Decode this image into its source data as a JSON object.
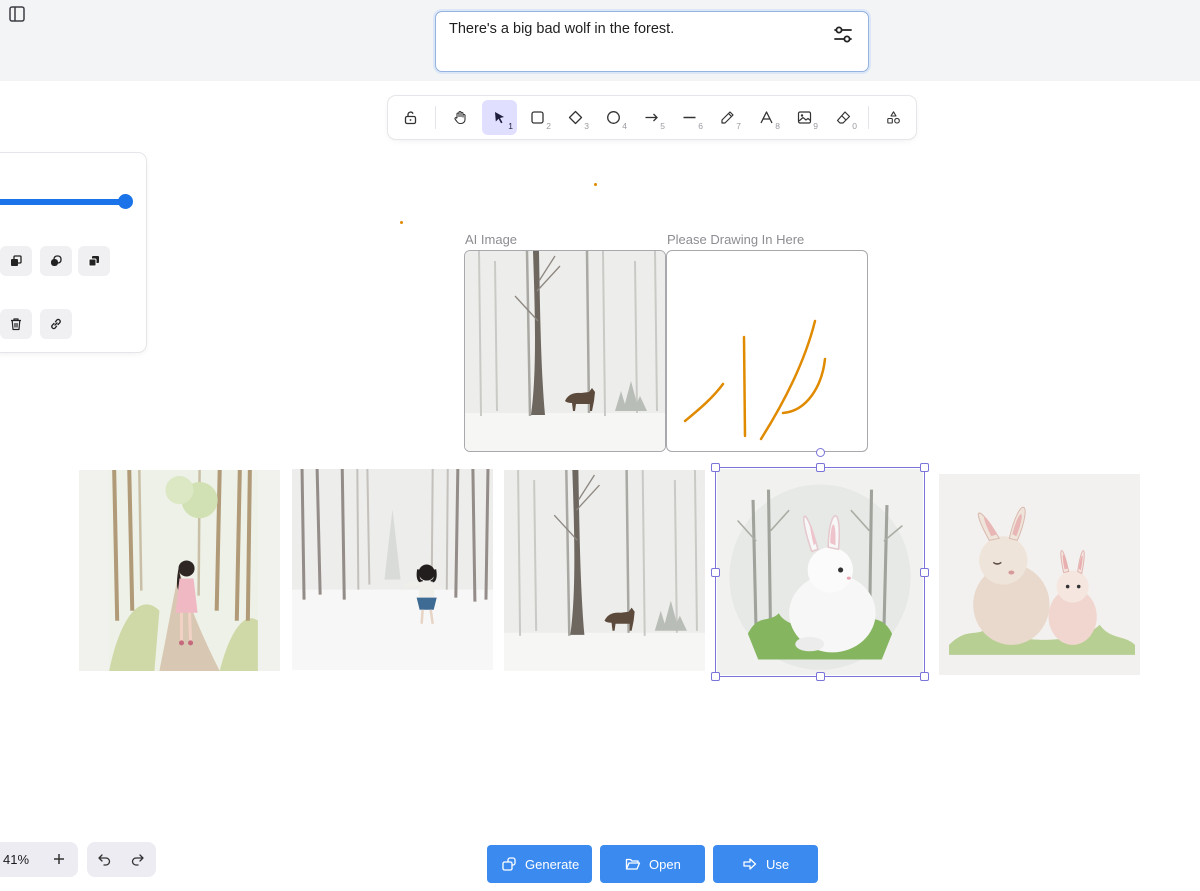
{
  "prompt": {
    "text": "There's a big bad wolf in the forest.",
    "settings_icon": "sliders-icon"
  },
  "toolbar": {
    "tools": [
      {
        "name": "lock",
        "key": ""
      },
      {
        "name": "hand",
        "key": ""
      },
      {
        "name": "selection",
        "key": "1"
      },
      {
        "name": "rectangle",
        "key": "2"
      },
      {
        "name": "diamond",
        "key": "3"
      },
      {
        "name": "ellipse",
        "key": "4"
      },
      {
        "name": "arrow",
        "key": "5"
      },
      {
        "name": "line",
        "key": "6"
      },
      {
        "name": "draw",
        "key": "7"
      },
      {
        "name": "text",
        "key": "8"
      },
      {
        "name": "image",
        "key": "9"
      },
      {
        "name": "eraser",
        "key": "0"
      },
      {
        "name": "library",
        "key": ""
      }
    ],
    "active_tool": "selection"
  },
  "panel": {
    "opacity_value": 100
  },
  "frames": {
    "ai_label": "AI Image",
    "drawing_label": "Please Drawing In Here"
  },
  "gallery": {
    "images": [
      {
        "id": "girl-path-forest"
      },
      {
        "id": "girl-snow-forest"
      },
      {
        "id": "wolf-snow-forest"
      },
      {
        "id": "white-rabbit-forest"
      },
      {
        "id": "two-rabbits"
      }
    ],
    "selected_index": 3
  },
  "zoom": {
    "level": "41%"
  },
  "actions": {
    "generate": "Generate",
    "open": "Open",
    "use": "Use"
  },
  "colors": {
    "accent": "#3b8af0",
    "selection": "#7a73d9",
    "stroke": "#e08a00",
    "active_tool": "#e0dfff"
  }
}
